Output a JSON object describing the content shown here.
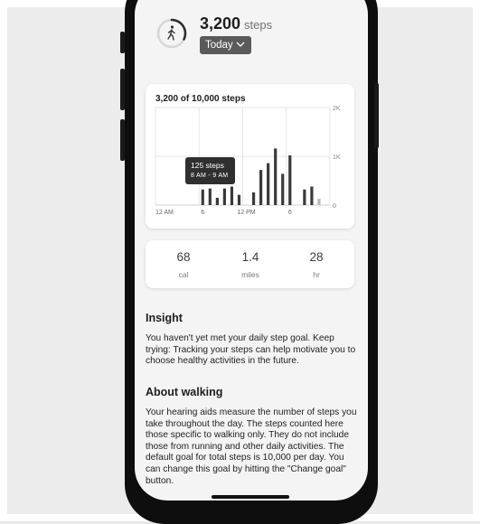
{
  "summary": {
    "step_count": "3,200",
    "step_unit": "steps",
    "period": "Today",
    "icon": "walking-person-icon"
  },
  "chart_data": {
    "type": "bar",
    "title": "3,200 of 10,000 steps",
    "x_tick_labels": [
      "12 AM",
      "6",
      "12 PM",
      "6"
    ],
    "y_tick_labels": [
      "2K",
      "1K",
      "0"
    ],
    "ylim": [
      0,
      2000
    ],
    "grid": true,
    "bar_color": "#3a3a3a",
    "highlight_color": "#b9b9b9",
    "hours": [
      6,
      7,
      8,
      9,
      10,
      11,
      13,
      14,
      15,
      16,
      17,
      18,
      20,
      21,
      22
    ],
    "values": [
      320,
      340,
      150,
      340,
      380,
      210,
      260,
      720,
      860,
      1160,
      640,
      1020,
      320,
      380,
      130
    ],
    "tooltip": {
      "value_text": "125 steps",
      "range_text": "8 AM - 9 AM"
    }
  },
  "stats": [
    {
      "value": "68",
      "label": "cal"
    },
    {
      "value": "1.4",
      "label": "miles"
    },
    {
      "value": "28",
      "label": "hr"
    }
  ],
  "insight": {
    "heading": "Insight",
    "text": "You haven't yet met your daily step goal. Keep trying: Tracking your steps can help motivate you to choose healthy activities in the future."
  },
  "about": {
    "heading": "About walking",
    "text": "Your hearing aids measure the number of steps you take throughout the day. The steps counted here those specific to walking only. They do not include those from running and other daily activities. The default goal for total steps is 10,000 per day. You can change this goal by hitting the \"Change goal\" button."
  }
}
